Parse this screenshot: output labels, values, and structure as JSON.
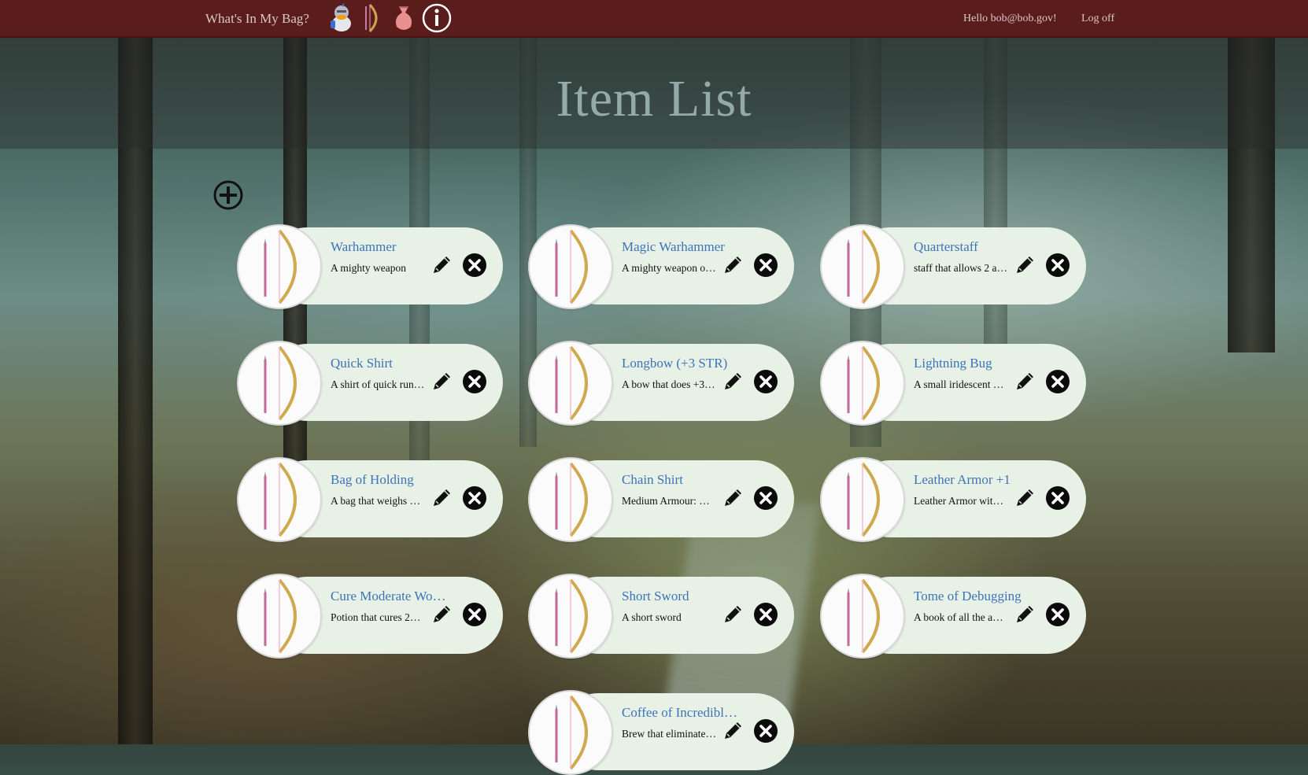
{
  "header": {
    "brand": "What's In My Bag?",
    "icons": [
      "knight-mascot-icon",
      "bow-arrow-icon",
      "loot-bag-icon",
      "info-icon"
    ],
    "greeting": "Hello bob@bob.gov!",
    "logoff": "Log off"
  },
  "hero": {
    "title": "Item List"
  },
  "add_button": {
    "icon": "plus-circle-icon"
  },
  "items": [
    {
      "name": "Warhammer",
      "description": "A mighty weapon"
    },
    {
      "name": "Magic Warhammer",
      "description": "A mighty weapon o…"
    },
    {
      "name": "Quarterstaff",
      "description": "staff that allows 2 a…"
    },
    {
      "name": "Quick Shirt",
      "description": "A shirt of quick run…"
    },
    {
      "name": "Longbow (+3 STR)",
      "description": "A bow that does +3…"
    },
    {
      "name": "Lightning Bug",
      "description": "A small iridescent …"
    },
    {
      "name": "Bag of Holding",
      "description": "A bag that weighs …"
    },
    {
      "name": "Chain Shirt",
      "description": "Medium Armour: …"
    },
    {
      "name": "Leather Armor +1",
      "description": "Leather Armor wit…"
    },
    {
      "name": "Cure Moderate Wo…",
      "description": "Potion that cures 2…"
    },
    {
      "name": "Short Sword",
      "description": "A short sword"
    },
    {
      "name": "Tome of Debugging",
      "description": "A book of all the a…"
    },
    {
      "name": "Coffee of Incredibl…",
      "description": "Brew that eliminate…"
    }
  ],
  "colors": {
    "header_bg": "#5b1c1c",
    "title_link": "#3d73b8",
    "card_bg": "#e8f1e6"
  }
}
